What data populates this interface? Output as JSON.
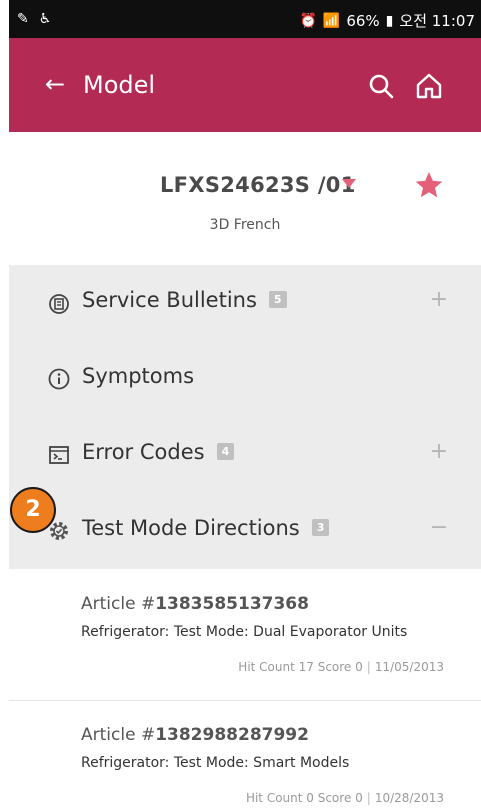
{
  "status_bar": {
    "right_text": "66%",
    "carrier_text": "오전 11:07"
  },
  "app_bar": {
    "back_icon": "←",
    "title": "Model"
  },
  "model": {
    "name": "LFXS24623S /01",
    "subtitle": "3D French"
  },
  "sections": [
    {
      "label": "Service Bulletins",
      "count": "5",
      "toggle": "+"
    },
    {
      "label": "Symptoms",
      "count": "",
      "toggle": ""
    },
    {
      "label": "Error Codes",
      "count": "4",
      "toggle": "+"
    },
    {
      "label": "Test Mode Directions",
      "count": "3",
      "toggle": "−"
    }
  ],
  "badge": "2",
  "articles": [
    {
      "prefix": "Article #",
      "number": "1383585137368",
      "title": "Refrigerator: Test Mode: Dual Evaporator Units",
      "hit_count": "Hit Count 17 Score 0",
      "date": "11/05/2013"
    },
    {
      "prefix": "Article #",
      "number": "1382988287992",
      "title": "Refrigerator: Test Mode: Smart Models",
      "hit_count": "Hit Count 0 Score 0",
      "date": "10/28/2013"
    }
  ],
  "colors": {
    "brand": "#b32a55",
    "accent": "#e46079",
    "badge": "#ee7d1e"
  }
}
